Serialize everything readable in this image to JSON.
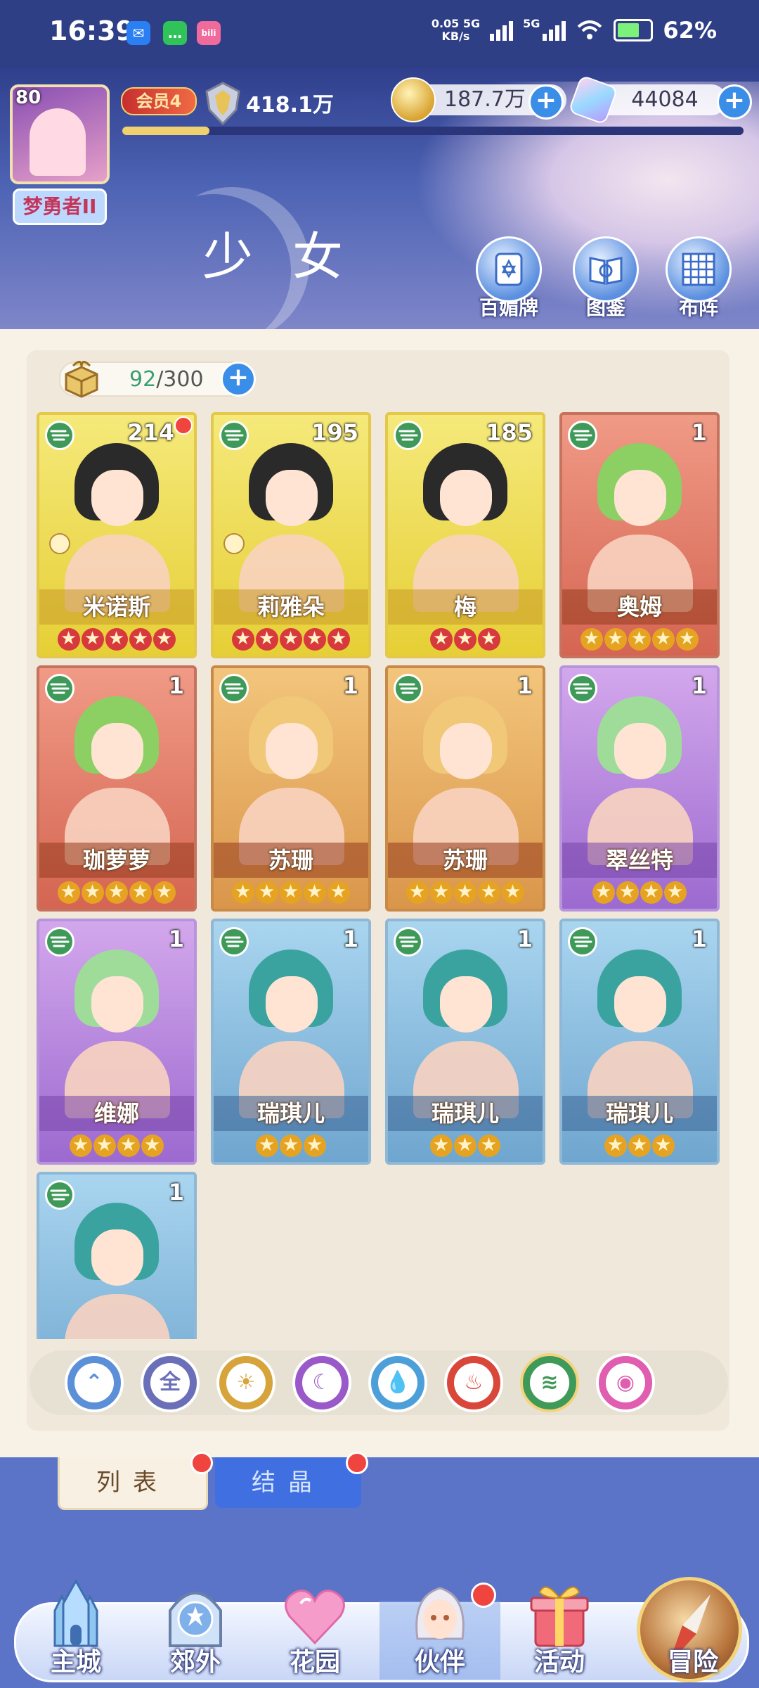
{
  "status_bar": {
    "time": "16:39",
    "apps": [
      "notification-app-icon",
      "chat-app-icon",
      "bilibili-app-icon"
    ],
    "net_speed_value": "0.05",
    "net_speed_unit": "KB/s",
    "network_1": "5G",
    "network_2": "5G",
    "battery": "62%"
  },
  "player": {
    "level": "80",
    "title": "梦勇者II",
    "vip": "会员4",
    "power": "418.1万"
  },
  "resources": {
    "gold": "187.7万",
    "gems": "44084"
  },
  "section": {
    "title": "少女"
  },
  "top_buttons": [
    {
      "label": "百媚牌",
      "icon": "card-icon"
    },
    {
      "label": "图鉴",
      "icon": "book-icon"
    },
    {
      "label": "布阵",
      "icon": "formation-grid-icon"
    }
  ],
  "capacity": {
    "current": "92",
    "max": "/300"
  },
  "cards": [
    {
      "name": "米诺斯",
      "count": "214",
      "stars": 5,
      "star_color": "red",
      "frame": "gold",
      "red_dot": true,
      "badge": true
    },
    {
      "name": "莉雅朵",
      "count": "195",
      "stars": 5,
      "star_color": "red",
      "frame": "gold",
      "red_dot": false,
      "badge": true
    },
    {
      "name": "梅",
      "count": "185",
      "stars": 3,
      "star_color": "red",
      "frame": "gold",
      "red_dot": false,
      "badge": false
    },
    {
      "name": "奥姆",
      "count": "1",
      "stars": 5,
      "star_color": "gold",
      "frame": "red",
      "red_dot": false,
      "badge": false
    },
    {
      "name": "珈萝萝",
      "count": "1",
      "stars": 5,
      "star_color": "gold",
      "frame": "red",
      "red_dot": false,
      "badge": false
    },
    {
      "name": "苏珊",
      "count": "1",
      "stars": 5,
      "star_color": "gold",
      "frame": "orange",
      "red_dot": false,
      "badge": false
    },
    {
      "name": "苏珊",
      "count": "1",
      "stars": 5,
      "star_color": "gold",
      "frame": "orange",
      "red_dot": false,
      "badge": false
    },
    {
      "name": "翠丝特",
      "count": "1",
      "stars": 4,
      "star_color": "gold",
      "frame": "purple",
      "red_dot": false,
      "badge": false
    },
    {
      "name": "维娜",
      "count": "1",
      "stars": 4,
      "star_color": "gold",
      "frame": "purple",
      "red_dot": false,
      "badge": false
    },
    {
      "name": "瑞琪儿",
      "count": "1",
      "stars": 3,
      "star_color": "gold",
      "frame": "blue",
      "red_dot": false,
      "badge": false
    },
    {
      "name": "瑞琪儿",
      "count": "1",
      "stars": 3,
      "star_color": "gold",
      "frame": "blue",
      "red_dot": false,
      "badge": false
    },
    {
      "name": "瑞琪儿",
      "count": "1",
      "stars": 3,
      "star_color": "gold",
      "frame": "blue",
      "red_dot": false,
      "badge": false
    },
    {
      "name": "",
      "count": "1",
      "stars": 0,
      "star_color": "gold",
      "frame": "blue",
      "red_dot": false,
      "badge": false
    }
  ],
  "filters": [
    {
      "id": "sort",
      "label": "",
      "color": "#5b8fd8"
    },
    {
      "id": "all",
      "label": "全",
      "color": "#6b6fb8"
    },
    {
      "id": "light",
      "label": "",
      "color": "#d7a33b"
    },
    {
      "id": "dark",
      "label": "",
      "color": "#9a59c8"
    },
    {
      "id": "water",
      "label": "",
      "color": "#4c9fd8"
    },
    {
      "id": "fire",
      "label": "",
      "color": "#d9473a"
    },
    {
      "id": "wind",
      "label": "",
      "color": "#3f9a59",
      "selected": true
    },
    {
      "id": "spirit",
      "label": "",
      "color": "#e05db0"
    }
  ],
  "tabs": {
    "list": "列表",
    "crystal": "结晶"
  },
  "bottom_nav": [
    {
      "label": "主城",
      "icon": "castle-icon"
    },
    {
      "label": "郊外",
      "icon": "portal-icon"
    },
    {
      "label": "花园",
      "icon": "heart-icon"
    },
    {
      "label": "伙伴",
      "icon": "companion-icon",
      "active": true
    },
    {
      "label": "活动",
      "icon": "gift-icon"
    },
    {
      "label": "冒险",
      "icon": "compass-icon"
    }
  ],
  "colors": {
    "accent": "#3a8ee8",
    "status_red": "#f0443e",
    "wind_element": "#3f9a59"
  }
}
